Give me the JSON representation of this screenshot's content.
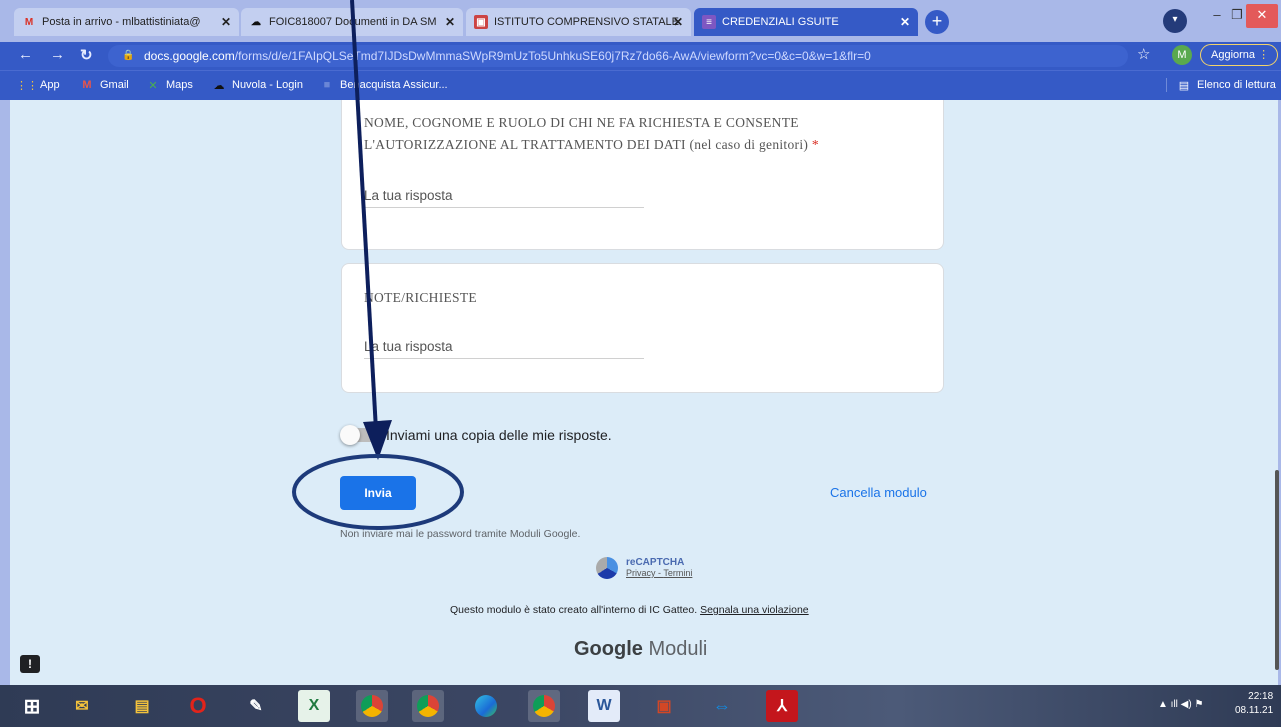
{
  "browser": {
    "tabs": [
      {
        "label": "Posta in arrivo - mlbattistiniata@",
        "icon": "gmail-icon",
        "active": false
      },
      {
        "label": "FOIC818007 Documenti in DA SM",
        "icon": "cloud-icon",
        "active": false
      },
      {
        "label": "ISTITUTO COMPRENSIVO STATALE",
        "icon": "school-icon",
        "active": false
      },
      {
        "label": "CREDENZIALI GSUITE",
        "icon": "forms-icon",
        "active": true
      }
    ],
    "url_domain": "docs.google.com",
    "url_path": "/forms/d/e/1FAIpQLSeTmd7IJDsDwMmmaSWpR9mUzTo5UnhkuSE60j7Rz7do66-AwA/viewform?vc=0&c=0&w=1&flr=0",
    "avatar_letter": "M",
    "update_label": "Aggiorna",
    "bookmarks": [
      "App",
      "Gmail",
      "Maps",
      "Nuvola - Login",
      "Benacquista Assicur..."
    ],
    "reading_list": "Elenco di lettura"
  },
  "form": {
    "question1": {
      "line1": "NOME, COGNOME E RUOLO DI CHI NE FA RICHIESTA E CONSENTE",
      "line2": "L'AUTORIZZAZIONE AL TRATTAMENTO DEI DATI (nel caso di genitori)",
      "required_mark": "*",
      "placeholder": "La tua risposta"
    },
    "question2": {
      "title": "NOTE/RICHIESTE",
      "placeholder": "La tua risposta"
    },
    "copy_toggle_label": "Inviami una copia delle mie risposte.",
    "submit_label": "Invia",
    "clear_label": "Cancella modulo",
    "password_warning": "Non inviare mai le password tramite Moduli Google.",
    "recaptcha": {
      "title": "reCAPTCHA",
      "privacy": "Privacy",
      "terms": "Termini"
    },
    "footer_text": "Questo modulo è stato creato all'interno di IC Gatteo.",
    "report_link": "Segnala una violazione",
    "brand_google": "Google",
    "brand_product": "Moduli"
  },
  "taskbar": {
    "time": "22:18",
    "date": "08.11.21"
  },
  "annotation_color": "#0d1f5c"
}
